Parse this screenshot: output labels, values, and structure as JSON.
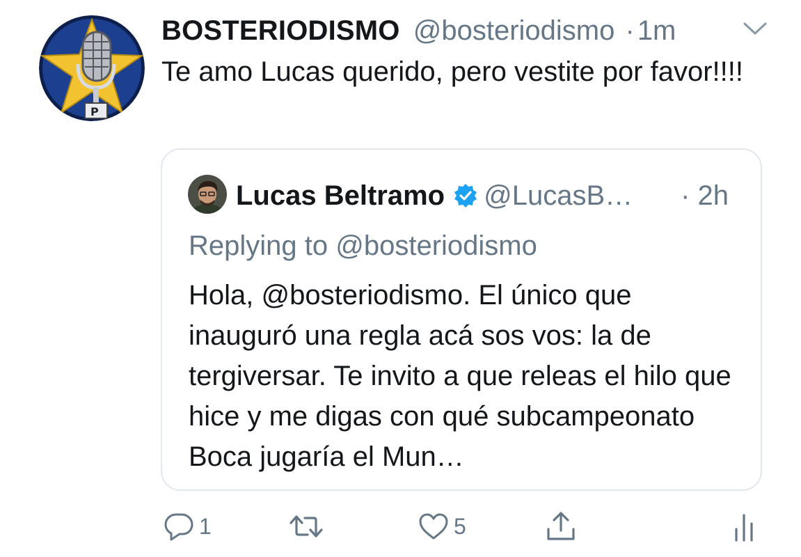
{
  "tweet": {
    "display_name": "BOSTERIODISMO",
    "handle": "@bosteriodismo",
    "separator": "·",
    "time": "1m",
    "text": "Te amo Lucas querido, pero vestite por favor!!!!"
  },
  "quoted": {
    "display_name": "Lucas Beltramo",
    "handle": "@LucasB…",
    "time": "· 2h",
    "replying_to": "Replying to @bosteriodismo",
    "text": "Hola, @bosteriodismo. El único que inauguró una regla acá sos vos: la de tergiversar. Te invito a que releas el hilo que hice y me digas con qué subcampeonato Boca jugaría el Mun…"
  },
  "actions": {
    "reply_count": "1",
    "retweet_count": "",
    "like_count": "5"
  },
  "colors": {
    "primary_text": "#14171a",
    "secondary_text": "#657786",
    "border": "#e1e8ed",
    "verified": "#1da1f2",
    "avatar_blue": "#1d3f8f",
    "avatar_star": "#f2c230"
  },
  "icons": [
    "avatar-microphone-star",
    "chevron-down-icon",
    "verified-badge-icon",
    "reply-icon",
    "retweet-icon",
    "like-icon",
    "share-icon",
    "analytics-icon"
  ]
}
